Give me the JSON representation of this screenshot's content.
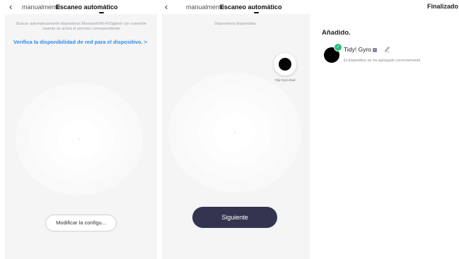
{
  "panel1": {
    "tabs": [
      {
        "label": "manualmente",
        "active": false
      },
      {
        "label": "Escaneo automático",
        "active": true
      }
    ],
    "note": "Buscar automáticamente dispositivos Bluetooth/Wi-Fi/Zigbee/ con conexión cuando se activa el permiso correspondiente",
    "link": "Verifica la disponibilidad de red para el dispositivo. >",
    "modify_button": "Modificar la configu..."
  },
  "panel2": {
    "tabs": [
      {
        "label": "manualmente",
        "active": false
      },
      {
        "label": "Escaneo automático",
        "active": true
      }
    ],
    "available_label": "Dispositivos disponibles",
    "device_label": "Tidy Gyro-final",
    "next_button": "Siguiente"
  },
  "panel3": {
    "done_button": "Finalizado",
    "section_title": "Añadido.",
    "device_name": "Tidy! Gyro",
    "device_status": "El dispositivo se ha agregado correctamente"
  },
  "icons": {
    "back": "chevron-left-icon",
    "edit": "pencil-icon",
    "check": "check-icon",
    "room": "room-icon"
  },
  "colors": {
    "primary_button": "#33344f",
    "link": "#2f8cf0",
    "success": "#2dbf7a"
  }
}
